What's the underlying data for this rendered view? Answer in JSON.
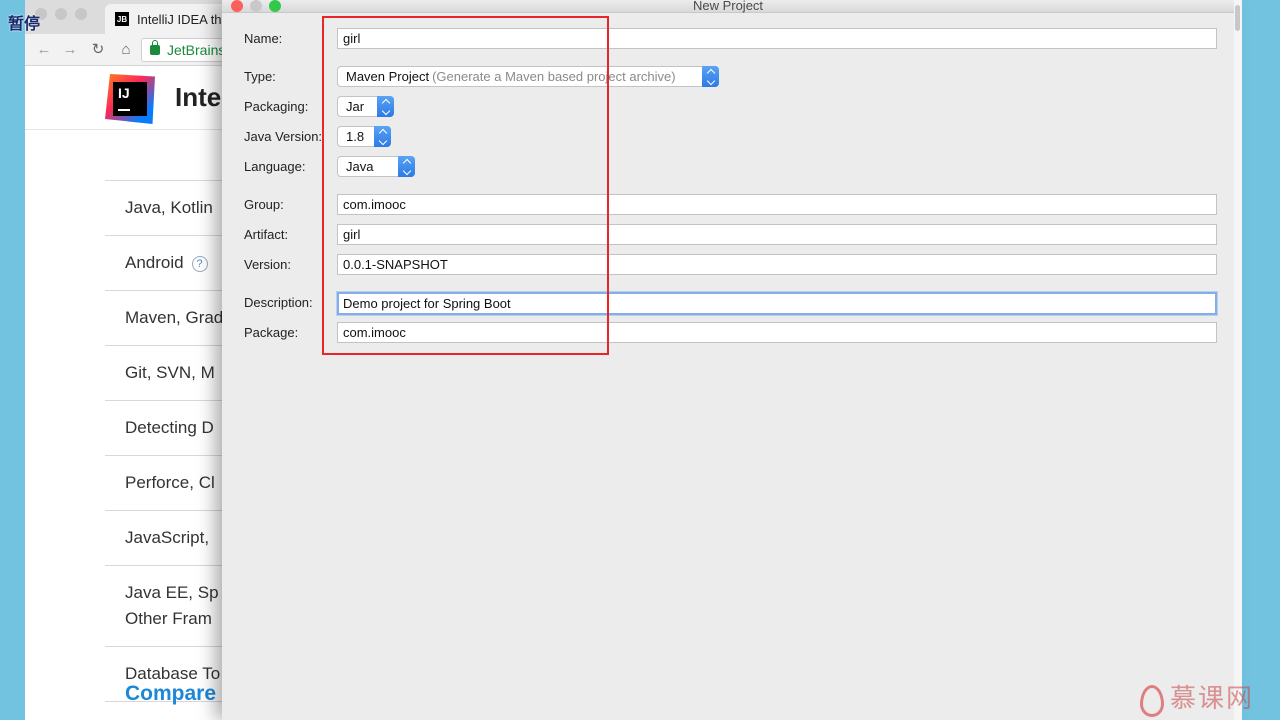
{
  "overlay": {
    "pause_label": "暂停"
  },
  "browser": {
    "tab_title": "IntelliJ IDEA the",
    "tab_icon_text": "JB",
    "url_text": "JetBrains",
    "site_logo_text": "IJ",
    "site_title": "Inte",
    "features": [
      "Java, Kotlin",
      "Android",
      "Maven, Grad",
      "Git, SVN, M",
      "Detecting D",
      "Perforce, Cl",
      "JavaScript,",
      "Java EE, Sp",
      "Database To"
    ],
    "feature_java_ee_line2": "Other Fram",
    "compare_link": "Compare"
  },
  "dialog": {
    "title": "New Project",
    "labels": {
      "name": "Name:",
      "type": "Type:",
      "packaging": "Packaging:",
      "java_version": "Java Version:",
      "language": "Language:",
      "group": "Group:",
      "artifact": "Artifact:",
      "version": "Version:",
      "description": "Description:",
      "package": "Package:"
    },
    "values": {
      "name": "girl",
      "type": "Maven Project",
      "type_hint": "(Generate a Maven based project archive)",
      "packaging": "Jar",
      "java_version": "1.8",
      "language": "Java",
      "group": "com.imooc",
      "artifact": "girl",
      "version": "0.0.1-SNAPSHOT",
      "description": "Demo project for Spring Boot",
      "package": "com.imooc"
    }
  },
  "watermark": {
    "text": "慕课网"
  },
  "colors": {
    "highlight": "#e8262a",
    "select_accent": "#2c7ae6",
    "focus_ring": "#86aee6",
    "link": "#1e88d8"
  }
}
